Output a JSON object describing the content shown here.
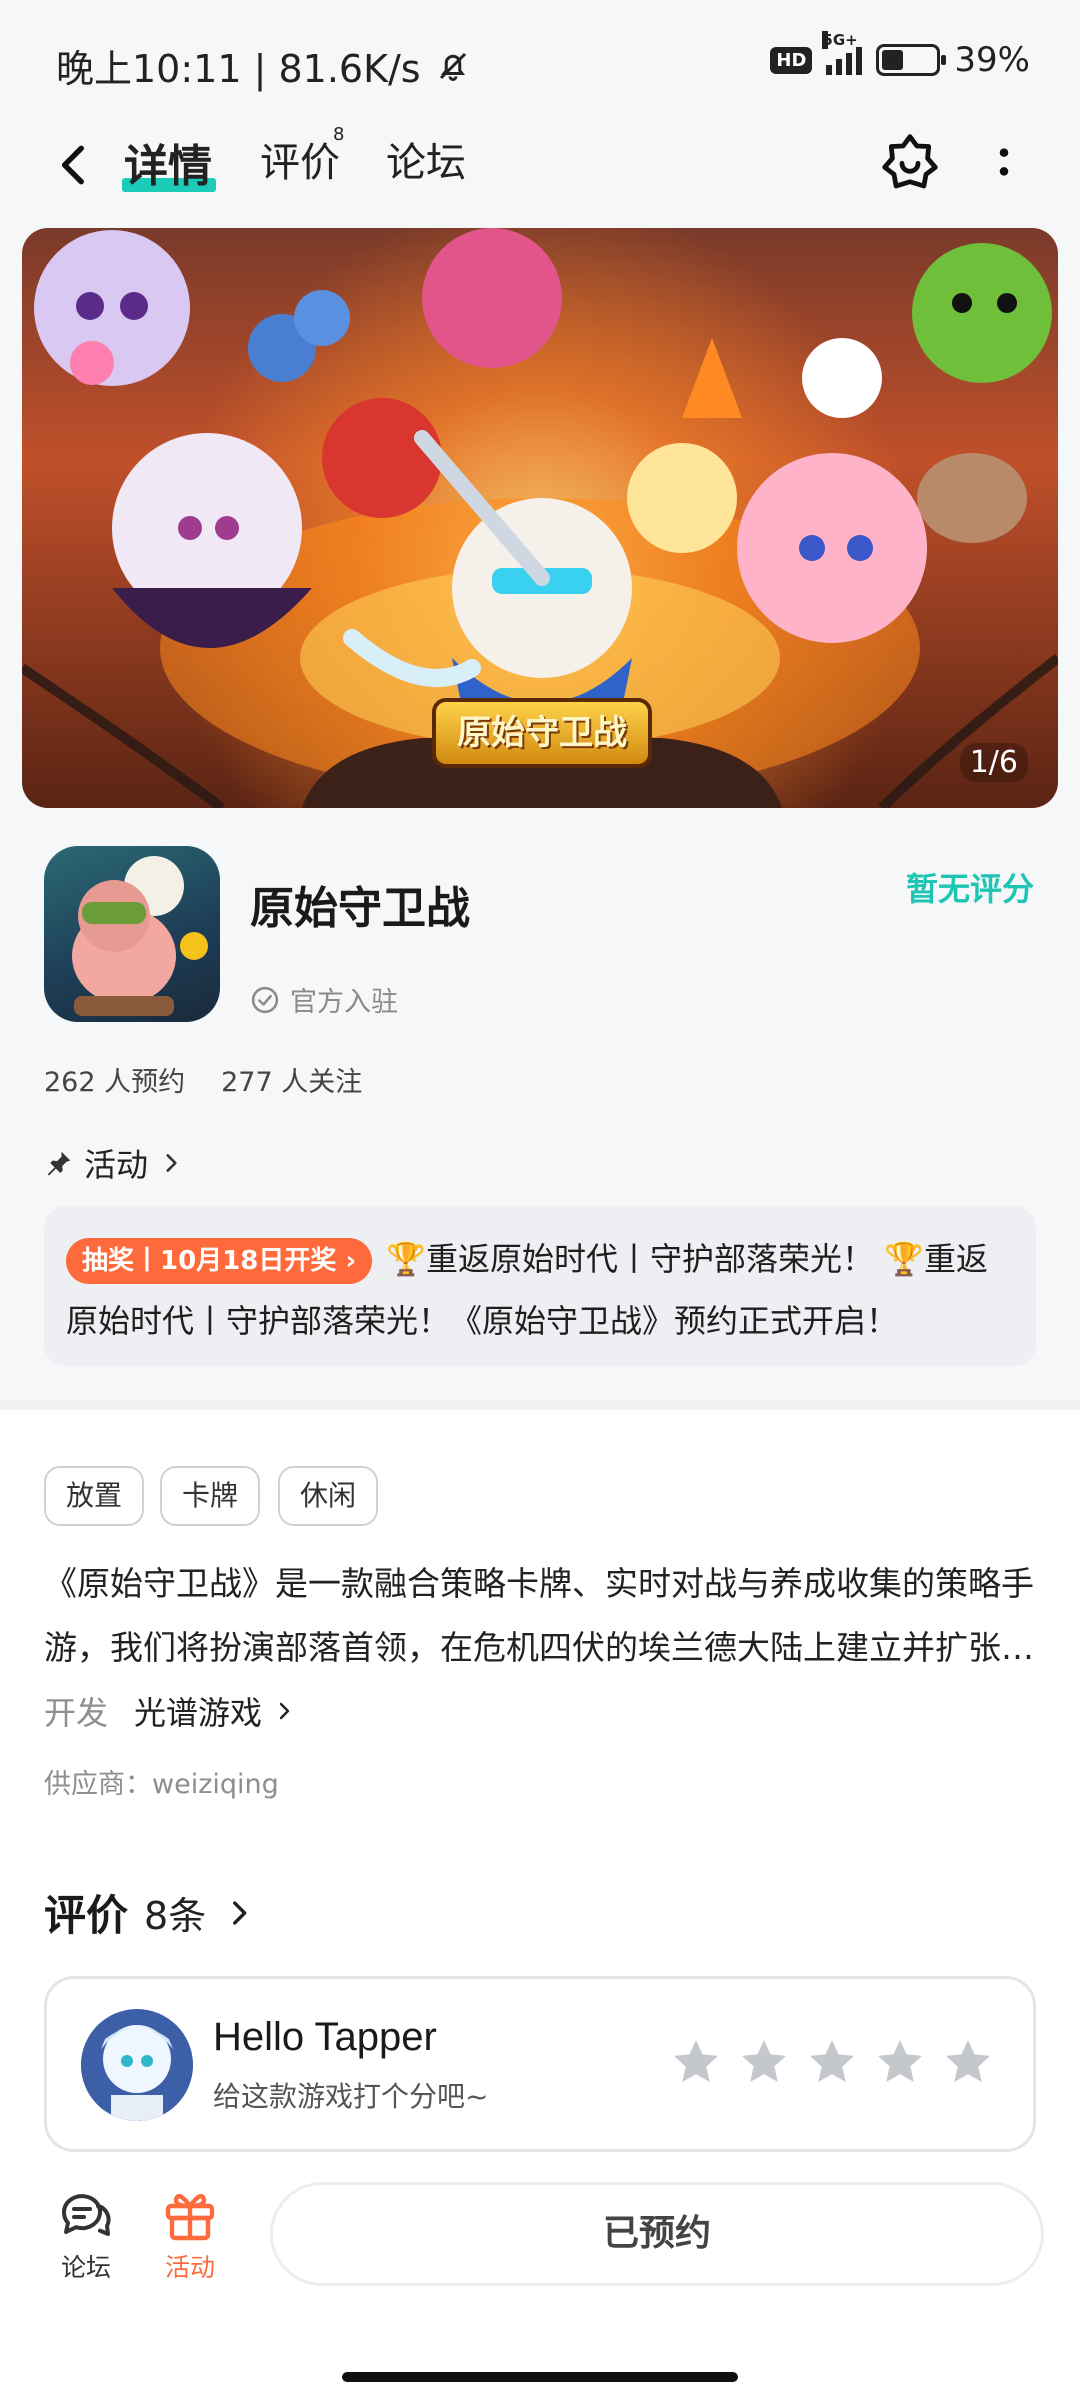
{
  "status_bar": {
    "time_speed": "晚上10:11 | 81.6K/s",
    "hd": "HD",
    "network": "5G+",
    "battery_percent": "39%",
    "battery_level": 0.39
  },
  "nav": {
    "tabs": [
      {
        "label": "详情",
        "active": true
      },
      {
        "label": "评价",
        "badge": "8"
      },
      {
        "label": "论坛"
      }
    ]
  },
  "banner": {
    "logo_text": "原始守卫战",
    "counter": "1/6"
  },
  "game": {
    "title": "原始守卫战",
    "rating": "暂无评分",
    "official": "官方入驻",
    "reservations": "262 人预约",
    "followers": "277 人关注"
  },
  "activity": {
    "heading": "活动",
    "badge": "抽奖丨10月18日开奖",
    "text": "🏆重返原始时代丨守护部落荣光！ 🏆重返原始时代丨守护部落荣光！《原始守卫战》预约正式开启！"
  },
  "tags": [
    "放置",
    "卡牌",
    "休闲"
  ],
  "description": {
    "line1": "《原始守卫战》是一款融合策略卡牌、实时对战与养成收集的策略手",
    "line2": "游，我们将扮演部落首领，在危机四伏的埃兰德大陆上建立并扩张…"
  },
  "developer": {
    "label": "开发",
    "name": "光谱游戏",
    "supplier": "供应商：weiziqing"
  },
  "reviews": {
    "title": "评价",
    "count": "8条",
    "user_name": "Hello Tapper",
    "prompt": "给这款游戏打个分吧~",
    "stars": 5
  },
  "bottom_bar": {
    "forum_label": "论坛",
    "activity_label": "活动",
    "main_button": "已预约"
  },
  "colors": {
    "accent_teal": "#1ccbb8",
    "activity_orange": "#ff6a3c",
    "star_gray": "#c4c7cc"
  }
}
